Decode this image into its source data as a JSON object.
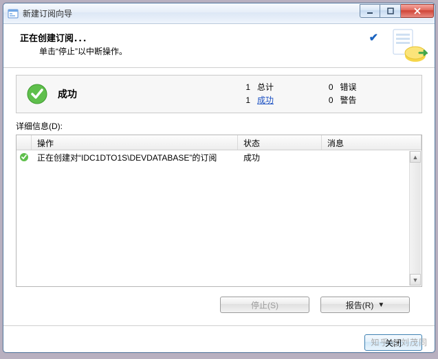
{
  "window": {
    "title": "新建订阅向导"
  },
  "header": {
    "title": "正在创建订阅．．．",
    "subtitle": "单击“停止”以中断操作。"
  },
  "summary": {
    "status_label": "成功",
    "total": {
      "n": "1",
      "label": "总计"
    },
    "success": {
      "n": "1",
      "label": "成功"
    },
    "error": {
      "n": "0",
      "label": "错误"
    },
    "warning": {
      "n": "0",
      "label": "警告"
    }
  },
  "details": {
    "label": "详细信息(D):",
    "columns": {
      "op": "操作",
      "state": "状态",
      "msg": "消息"
    },
    "rows": [
      {
        "op": "正在创建对“IDC1DTO1S\\DEVDATABASE”的订阅",
        "state": "成功",
        "msg": ""
      }
    ]
  },
  "buttons": {
    "stop": "停止(S)",
    "report": "报告(R)",
    "close": "关闭"
  },
  "watermark": "知乎 @刘茂同"
}
